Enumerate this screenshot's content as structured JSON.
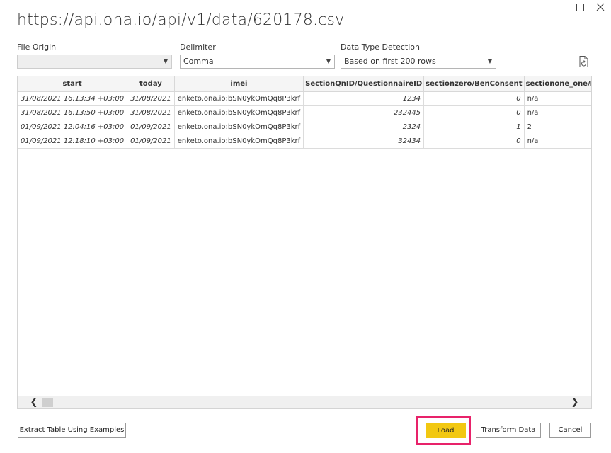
{
  "window": {
    "title": "https://api.ona.io/api/v1/data/620178.csv"
  },
  "options": {
    "file_origin": {
      "label": "File Origin",
      "value": ""
    },
    "delimiter": {
      "label": "Delimiter",
      "value": "Comma"
    },
    "data_type_detection": {
      "label": "Data Type Detection",
      "value": "Based on first 200 rows"
    }
  },
  "table": {
    "columns": [
      "start",
      "today",
      "imei",
      "SectionQnID/QuestionnaireID",
      "sectionzero/BenConsent",
      "sectionone_one/M"
    ],
    "rows": [
      [
        "31/08/2021 16:13:34 +03:00",
        "31/08/2021",
        "enketo.ona.io:bSN0ykOmQq8P3krf",
        "1234",
        "0",
        "n/a"
      ],
      [
        "31/08/2021 16:13:50 +03:00",
        "31/08/2021",
        "enketo.ona.io:bSN0ykOmQq8P3krf",
        "232445",
        "0",
        "n/a"
      ],
      [
        "01/09/2021 12:04:16 +03:00",
        "01/09/2021",
        "enketo.ona.io:bSN0ykOmQq8P3krf",
        "2324",
        "1",
        "2"
      ],
      [
        "01/09/2021 12:18:10 +03:00",
        "01/09/2021",
        "enketo.ona.io:bSN0ykOmQq8P3krf",
        "32434",
        "0",
        "n/a"
      ]
    ]
  },
  "footer": {
    "extract_label": "Extract Table Using Examples",
    "load_label": "Load",
    "transform_label": "Transform Data",
    "cancel_label": "Cancel"
  },
  "icons": {
    "maximize": "maximize-icon",
    "close": "close-icon",
    "refresh": "document-refresh-icon",
    "dropdown": "chevron-down-icon"
  },
  "colors": {
    "load_button": "#f2c811",
    "highlight_border": "#e8226a"
  }
}
